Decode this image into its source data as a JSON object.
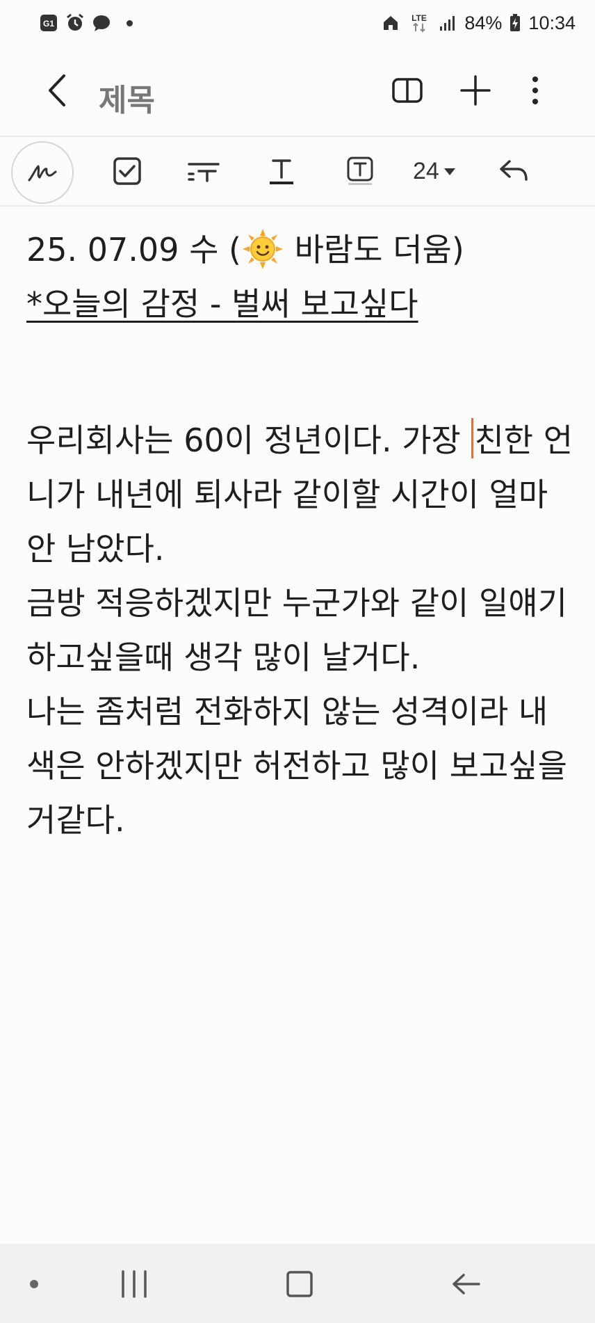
{
  "status_bar": {
    "battery": "84%",
    "time": "10:34",
    "network": "LTE"
  },
  "header": {
    "title": "제목"
  },
  "toolbar": {
    "font_size": "24"
  },
  "note": {
    "line1_before": "25. 07.09 수 (",
    "line1_after": " 바람도 더움)",
    "line2": "*오늘의 감정 - 벌써 보고싶다",
    "line3_before": "우리회사는 60이 정년이다. 가장 ",
    "line3_after": "친한 언",
    "line4": "니가 내년에 퇴사라 같이할 시간이 얼마",
    "line5": "안 남았다.",
    "line6": "금방 적응하겠지만 누군가와 같이 일얘기",
    "line7": "하고싶을때 생각 많이 날거다.",
    "line8": "나는 좀처럼 전화하지 않는 성격이라 내",
    "line9": "색은 안하겠지만 허전하고 많이 보고싶을",
    "line10": "거같다."
  },
  "colors": {
    "cursor": "#e0703a",
    "title_gray": "#777777",
    "navbar_bg": "#f1f1f3"
  }
}
